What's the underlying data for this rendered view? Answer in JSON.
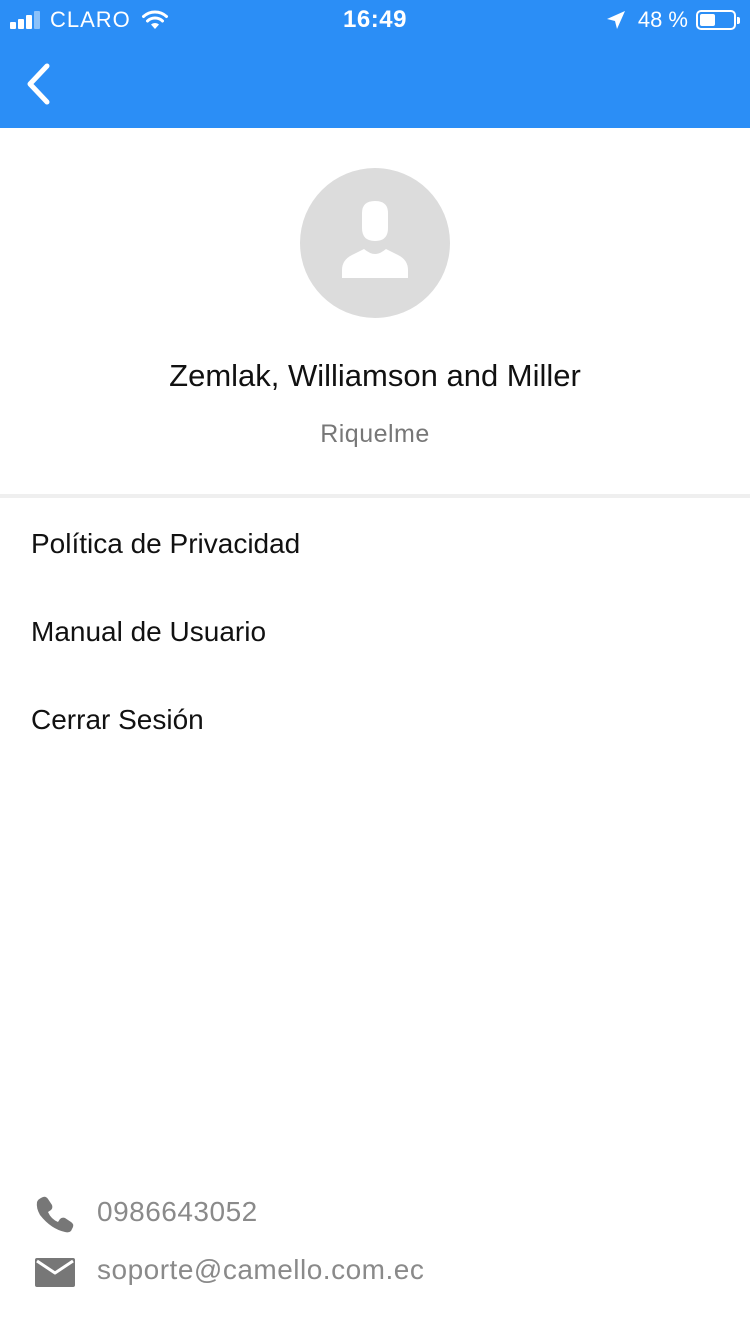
{
  "status_bar": {
    "carrier": "CLARO",
    "time": "16:49",
    "battery_percent": "48 %",
    "battery_level": 0.48,
    "signal_bars_active": 3,
    "signal_bars_total": 4
  },
  "nav": {
    "back_icon": "chevron-left-icon",
    "color": "#2b8ef6"
  },
  "profile": {
    "avatar_icon": "person-silhouette-icon",
    "company_name": "Zemlak, Williamson and Miller",
    "user_name": "Riquelme"
  },
  "menu": {
    "items": [
      {
        "label": "Política de Privacidad"
      },
      {
        "label": "Manual de Usuario"
      },
      {
        "label": "Cerrar Sesión"
      }
    ]
  },
  "contact": {
    "phone_icon": "phone-icon",
    "phone": "0986643052",
    "email_icon": "mail-icon",
    "email": "soporte@camello.com.ec"
  }
}
